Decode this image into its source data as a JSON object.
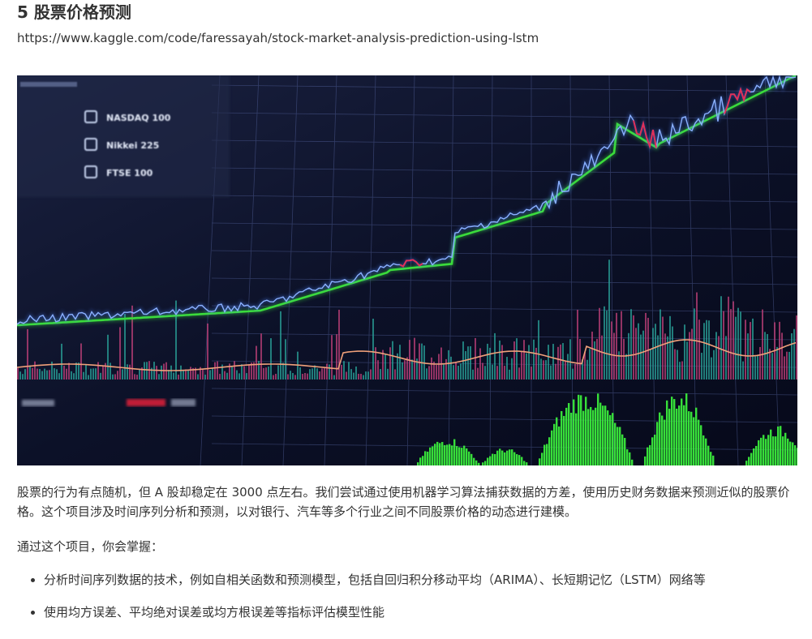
{
  "section": {
    "title": "5 股票价格预测",
    "link": "https://www.kaggle.com/code/faressayah/stock-market-analysis-prediction-using-lstm"
  },
  "hero_image": {
    "description_icon": "stock-chart-image",
    "legend_items": [
      "NASDAQ 100",
      "Nikkei 225",
      "FTSE 100"
    ],
    "colors": {
      "background": "#0b1025",
      "price": "#4f86ff",
      "trend": "#3bdc3b",
      "down": "#e0305a",
      "volume_up": "#2aa39a",
      "volume_down": "#c0407a",
      "oscillator": "#3df53d"
    }
  },
  "body": {
    "paragraph1": "股票的行为有点随机，但 A 股却稳定在 3000 点左右。我们尝试通过使用机器学习算法捕获数据的方差，使用历史财务数据来预测近似的股票价格。这个项目涉及时间序列分析和预测，以对银行、汽车等多个行业之间不同股票价格的动态进行建模。",
    "paragraph2": "通过这个项目，你会掌握：",
    "bullets": [
      "分析时间序列数据的技术，例如自相关函数和预测模型，包括自回归积分移动平均（ARIMA）、长短期记忆（LSTM）网络等",
      "使用均方误差、平均绝对误差或均方根误差等指标评估模型性能"
    ]
  }
}
